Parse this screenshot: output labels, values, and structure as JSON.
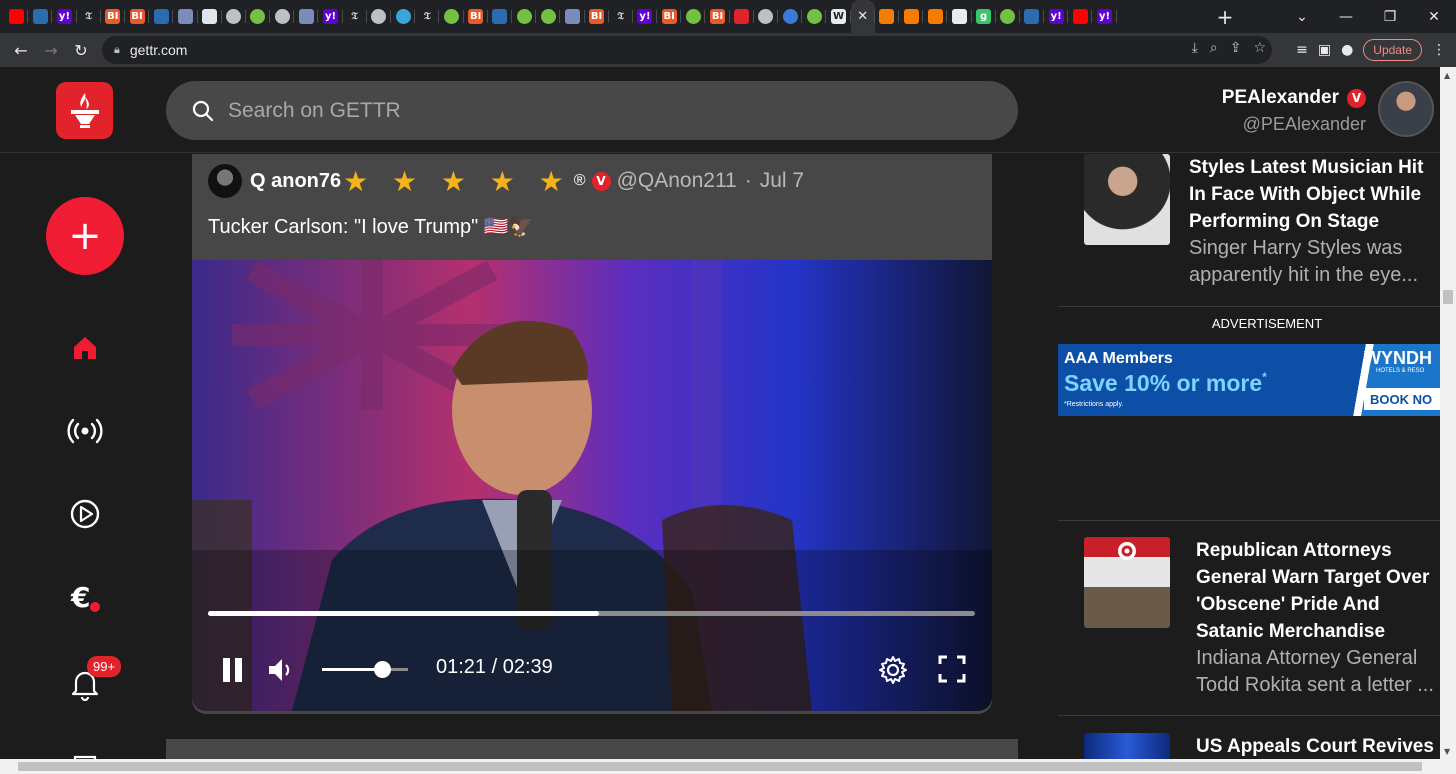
{
  "browser": {
    "tabs": [
      {
        "icon": "youtube-icon",
        "color": "#ff0000"
      },
      {
        "icon": "shield-icon",
        "color": "#2b6cb0"
      },
      {
        "icon": "yahoo-icon",
        "color": "#6001d2",
        "glyph": "y!"
      },
      {
        "icon": "nyt-icon",
        "color": "#202124",
        "glyph": "𝔗"
      },
      {
        "icon": "bi-icon",
        "color": "#e85a2a",
        "glyph": "BI"
      },
      {
        "icon": "bi-icon",
        "color": "#e85a2a",
        "glyph": "BI"
      },
      {
        "icon": "shield-icon",
        "color": "#2b6cb0"
      },
      {
        "icon": "flag-icon",
        "color": "#7a8db8"
      },
      {
        "icon": "grid-icon",
        "color": "#dfe6ee"
      },
      {
        "icon": "globe-icon",
        "color": "#bdc1c6"
      },
      {
        "icon": "rumble-icon",
        "color": "#74c043"
      },
      {
        "icon": "globe-icon",
        "color": "#bdc1c6"
      },
      {
        "icon": "flag-icon",
        "color": "#7a8db8"
      },
      {
        "icon": "yahoo-icon",
        "color": "#6001d2",
        "glyph": "y!"
      },
      {
        "icon": "nyt-icon",
        "color": "#202124",
        "glyph": "𝔗"
      },
      {
        "icon": "globe-icon",
        "color": "#bdc1c6"
      },
      {
        "icon": "globe-icon",
        "color": "#3aa6d6"
      },
      {
        "icon": "nyt-icon",
        "color": "#202124",
        "glyph": "𝔗"
      },
      {
        "icon": "rumble-icon",
        "color": "#74c043"
      },
      {
        "icon": "bi-icon",
        "color": "#e85a2a",
        "glyph": "BI"
      },
      {
        "icon": "shield-icon",
        "color": "#2b6cb0"
      },
      {
        "icon": "rumble-icon",
        "color": "#74c043"
      },
      {
        "icon": "rumble-icon",
        "color": "#74c043"
      },
      {
        "icon": "flag-icon",
        "color": "#7a8db8"
      },
      {
        "icon": "bi-icon",
        "color": "#e85a2a",
        "glyph": "BI"
      },
      {
        "icon": "nyt-icon",
        "color": "#202124",
        "glyph": "𝔗"
      },
      {
        "icon": "yahoo-icon",
        "color": "#6001d2",
        "glyph": "y!"
      },
      {
        "icon": "bi-icon",
        "color": "#e85a2a",
        "glyph": "BI"
      },
      {
        "icon": "rumble-icon",
        "color": "#74c043"
      },
      {
        "icon": "bi-icon",
        "color": "#e85a2a",
        "glyph": "BI"
      },
      {
        "icon": "mic-icon",
        "color": "#e3232c"
      },
      {
        "icon": "globe-icon",
        "color": "#bdc1c6"
      },
      {
        "icon": "search-icon",
        "color": "#3a7bd5"
      },
      {
        "icon": "rumble-icon",
        "color": "#74c043"
      },
      {
        "icon": "wsj-icon",
        "color": "#e8eaed",
        "glyph": "W"
      },
      {
        "icon": "close-icon",
        "color": "#e8eaed",
        "glyph": "✕",
        "active": true
      },
      {
        "icon": "bookmark-icon",
        "color": "#f57c00"
      },
      {
        "icon": "bookmark-icon",
        "color": "#f57c00"
      },
      {
        "icon": "bookmark-icon",
        "color": "#f57c00"
      },
      {
        "icon": "square-icon",
        "color": "#e8eaed"
      },
      {
        "icon": "g-icon",
        "color": "#3ac569",
        "glyph": "g"
      },
      {
        "icon": "rumble-icon",
        "color": "#74c043"
      },
      {
        "icon": "shield-icon",
        "color": "#2b6cb0"
      },
      {
        "icon": "yahoo-icon",
        "color": "#6001d2",
        "glyph": "y!"
      },
      {
        "icon": "youtube-icon",
        "color": "#ff0000"
      },
      {
        "icon": "yahoo-icon",
        "color": "#6001d2",
        "glyph": "y!"
      }
    ],
    "url": "gettr.com",
    "update_label": "Update"
  },
  "header": {
    "search_placeholder": "Search on GETTR",
    "user_display_name": "PEAlexander",
    "user_badge": "V",
    "user_handle": "@PEAlexander"
  },
  "sidebar": {
    "notification_count": "99+"
  },
  "post": {
    "author_name": "Q anon76",
    "stars": "★ ★ ★ ★ ★",
    "reg_mark": "®",
    "badge": "V",
    "handle": "@QAnon211",
    "separator": "·",
    "date": "Jul 7",
    "text": "Tucker Carlson: \"I love Trump\" 🇺🇸🦅",
    "video": {
      "progress": 0.51,
      "volume": 0.7,
      "time": "01:21 / 02:39"
    }
  },
  "right_sidebar": {
    "news": [
      {
        "title": "Styles Latest Musician Hit In Face With Object While Performing On Stage",
        "desc": "Singer Harry Styles was apparently hit in the eye..."
      },
      {
        "title": "Republican Attorneys General Warn Target Over 'Obscene' Pride And Satanic Merchandise",
        "desc": "Indiana Attorney General Todd Rokita sent a letter ..."
      },
      {
        "title": "US Appeals Court Revives",
        "desc": ""
      }
    ],
    "ad_label": "ADVERTISEMENT",
    "ad": {
      "line1": "AAA Members",
      "line2": "Save 10% or more",
      "line2_mark": "*",
      "line3": "*Restrictions apply.",
      "brand": "WYNDH",
      "brand_sub": "HOTELS & RESO",
      "cta": "BOOK NO"
    }
  }
}
